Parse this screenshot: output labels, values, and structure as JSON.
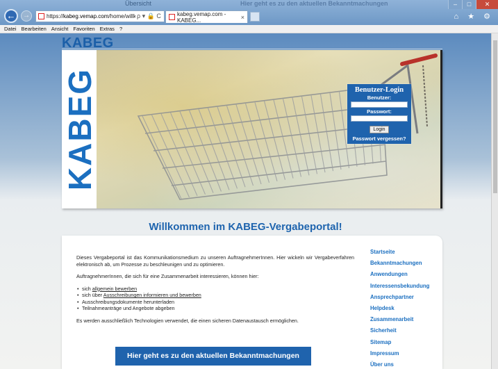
{
  "browser": {
    "ghost_tabs": [
      "Übersicht",
      "Hier geht es zu den aktuellen Bekanntmachungen"
    ],
    "address": {
      "prefix": "https://",
      "domain": "kabeg.vemap.com",
      "path": "/home/willkomm",
      "icons": "ρ ▾ 🔒 C"
    },
    "tab_title": "kabeg.vemap.com - KABEG...",
    "tab_close": "×",
    "back": "←",
    "forward": "→",
    "window_buttons": {
      "minimize": "–",
      "maximize": "□",
      "close": "✕"
    },
    "right_icons": "⌂ ★ ⚙",
    "menu": [
      "Datei",
      "Bearbeiten",
      "Ansicht",
      "Favoriten",
      "Extras",
      "?"
    ]
  },
  "site": {
    "logo_small": "KABEG",
    "logo_vertical": "KABEG",
    "accent": "#1f63ad"
  },
  "login": {
    "title": "Benutzer-Login",
    "user_label": "Benutzer:",
    "password_label": "Passwort:",
    "button": "Login",
    "forgot": "Passwort vergessen?"
  },
  "welcome": "Willkommen im KABEG-Vergabeportal!",
  "content": {
    "intro": "Dieses Vergabeportal ist das Kommunikationsmedium zu unseren AuftragnehmerInnen. Hier wickeln wir Vergabeverfahren elektronisch ab, um Prozesse zu beschleunigen und zu optimieren.",
    "lead": "AuftragnehmerInnen, die sich für eine Zusammenarbeit interessieren, können hier:",
    "bullets": [
      {
        "pre": "sich ",
        "link": "allgemein bewerben",
        "post": ""
      },
      {
        "pre": "sich über ",
        "link": "Ausschreibungen informieren und bewerben",
        "post": ""
      },
      {
        "pre": "Ausschreibungsdokumente herunterladen",
        "link": "",
        "post": ""
      },
      {
        "pre": "Teilnahmeanträge und Angebote abgeben",
        "link": "",
        "post": ""
      }
    ],
    "note": "Es werden ausschließlich Technologien verwendet, die einen sicheren Datenaustausch ermöglichen.",
    "cta": "Hier geht es zu den aktuellen Bekanntmachungen"
  },
  "side_nav": [
    "Startseite",
    "Bekanntmachungen",
    "Anwendungen",
    "Interessensbekundung",
    "Ansprechpartner",
    "Helpdesk",
    "Zusammenarbeit",
    "Sicherheit",
    "Sitemap",
    "Impressum",
    "Über uns"
  ]
}
